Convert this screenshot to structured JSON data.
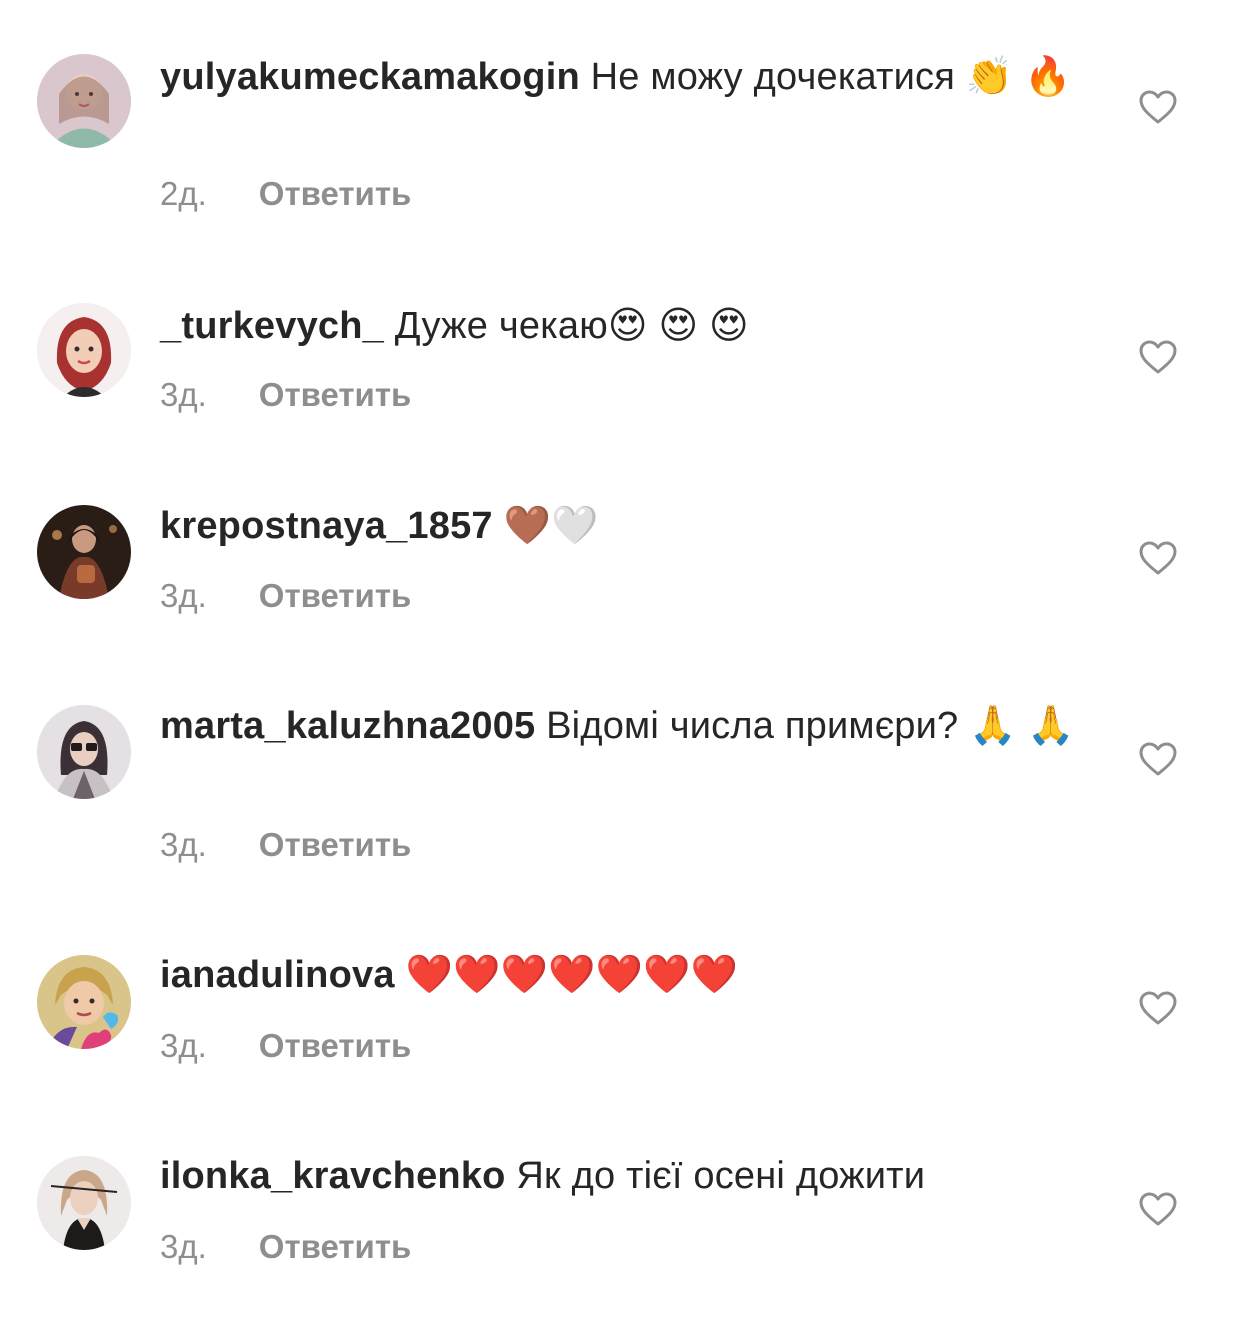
{
  "comments": [
    {
      "username": "yulyakumeckamakogin",
      "text": "Не можу дочекатися 👏 🔥",
      "time": "2д.",
      "reply_label": "Ответить",
      "avatar_colors": [
        "#d8c2c8",
        "#b07a88"
      ]
    },
    {
      "username": "_turkevych_",
      "text": "Дуже чекаю😍 😍 😍",
      "time": "3д.",
      "reply_label": "Ответить",
      "avatar_colors": [
        "#f3e6e6",
        "#c8403d"
      ]
    },
    {
      "username": "krepostnaya_1857",
      "text": "🤎🤍",
      "time": "3д.",
      "reply_label": "Ответить",
      "avatar_colors": [
        "#3a2a20",
        "#9a5a3c"
      ]
    },
    {
      "username": "marta_kaluzhna2005",
      "text": "Відомі числа примєри? 🙏 🙏",
      "time": "3д.",
      "reply_label": "Ответить",
      "avatar_colors": [
        "#d6d0d4",
        "#5a4f55"
      ]
    },
    {
      "username": "ianadulinova",
      "text": "❤️❤️❤️❤️❤️❤️❤️",
      "time": "3д.",
      "reply_label": "Ответить",
      "avatar_colors": [
        "#e7d6a0",
        "#7a6f3a"
      ]
    },
    {
      "username": "ilonka_kravchenko",
      "text": "Як до тієї осені дожити",
      "time": "3д.",
      "reply_label": "Ответить",
      "avatar_colors": [
        "#e6e2e2",
        "#3b3434"
      ]
    }
  ],
  "icons": {
    "like": "heart-outline-icon"
  }
}
